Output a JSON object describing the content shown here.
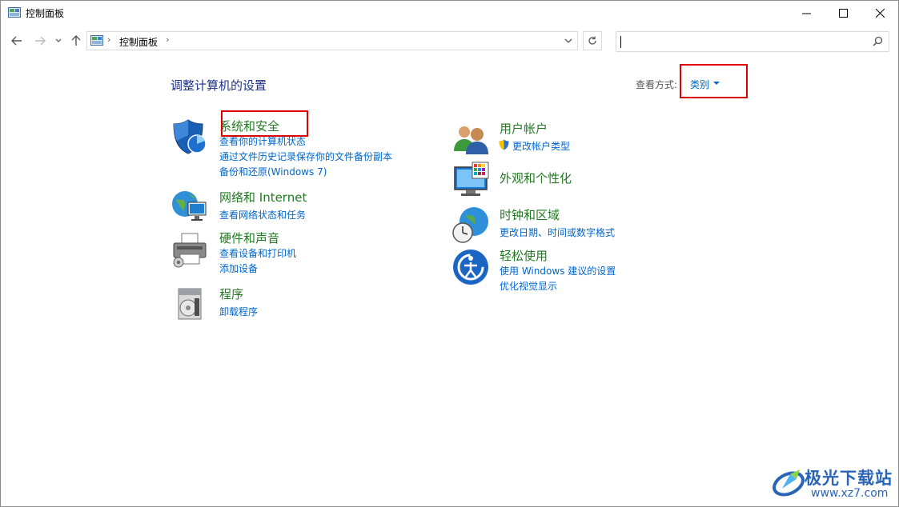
{
  "window": {
    "title": "控制面板",
    "controls": {
      "minimize": "minimize-icon",
      "maximize": "maximize-icon",
      "close": "close-icon"
    }
  },
  "address": {
    "crumbs": [
      "控制面板"
    ],
    "search_placeholder": ""
  },
  "content": {
    "heading": "调整计算机的设置",
    "view_by_label": "查看方式:",
    "view_by_value": "类别"
  },
  "categories_left": [
    {
      "title": "系统和安全",
      "icon": "shield-icon",
      "links": [
        "查看你的计算机状态",
        "通过文件历史记录保存你的文件备份副本",
        "备份和还原(Windows 7)"
      ]
    },
    {
      "title": "网络和 Internet",
      "icon": "network-icon",
      "links": [
        "查看网络状态和任务"
      ]
    },
    {
      "title": "硬件和声音",
      "icon": "printer-icon",
      "links": [
        "查看设备和打印机",
        "添加设备"
      ]
    },
    {
      "title": "程序",
      "icon": "programs-icon",
      "links": [
        "卸载程序"
      ]
    }
  ],
  "categories_right": [
    {
      "title": "用户帐户",
      "icon": "users-icon",
      "links": [
        "更改帐户类型"
      ]
    },
    {
      "title": "外观和个性化",
      "icon": "monitor-icon",
      "links": []
    },
    {
      "title": "时钟和区域",
      "icon": "clock-globe-icon",
      "links": [
        "更改日期、时间或数字格式"
      ]
    },
    {
      "title": "轻松使用",
      "icon": "ease-of-access-icon",
      "links": [
        "使用 Windows 建议的设置",
        "优化视觉显示"
      ]
    }
  ],
  "colors": {
    "category_title": "#217a21",
    "link": "#0066cc",
    "heading": "#1e3287",
    "highlight": "#e00000"
  },
  "watermark": {
    "name": "极光下载站",
    "url": "www.xz7.com"
  }
}
